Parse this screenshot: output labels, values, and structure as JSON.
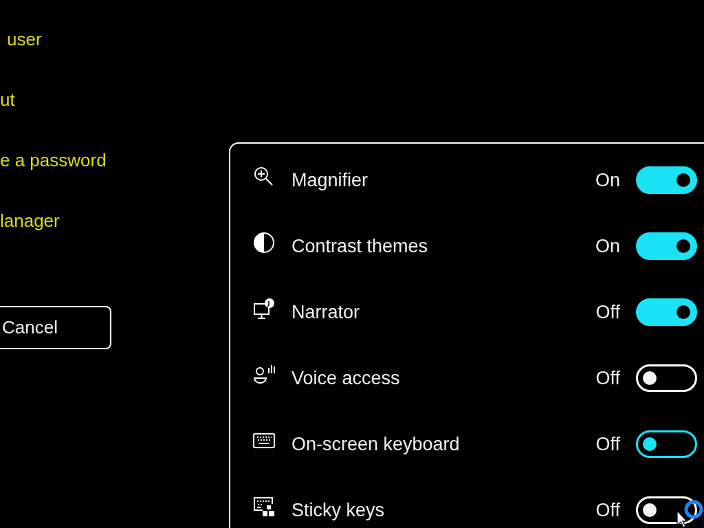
{
  "left_panel": {
    "options": [
      "user",
      "ut",
      "e a password",
      "lanager"
    ],
    "cancel_button": "Cancel"
  },
  "accessibility_panel": {
    "items": [
      {
        "kind": "magnifier",
        "label": "Magnifier",
        "status": "On",
        "on": true,
        "hovered": false
      },
      {
        "kind": "contrast",
        "label": "Contrast themes",
        "status": "On",
        "on": true,
        "hovered": false
      },
      {
        "kind": "narrator",
        "label": "Narrator",
        "status": "Off",
        "on": true,
        "hovered": false
      },
      {
        "kind": "voice",
        "label": "Voice access",
        "status": "Off",
        "on": false,
        "hovered": false
      },
      {
        "kind": "keyboard",
        "label": "On-screen keyboard",
        "status": "Off",
        "on": false,
        "hovered": true
      },
      {
        "kind": "sticky",
        "label": "Sticky keys",
        "status": "Off",
        "on": false,
        "hovered": false
      }
    ]
  }
}
